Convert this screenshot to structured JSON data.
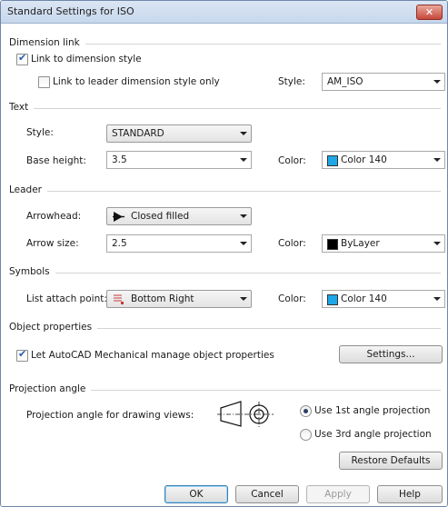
{
  "window": {
    "title": "Standard Settings for ISO",
    "close_glyph": "✕"
  },
  "dimension_link": {
    "heading": "Dimension link",
    "link_dim_style": {
      "label": "Link to dimension style",
      "checked": true
    },
    "link_leader_only": {
      "label": "Link to leader dimension style only",
      "checked": false
    },
    "style_label": "Style:",
    "style_value": "AM_ISO"
  },
  "text": {
    "heading": "Text",
    "style_label": "Style:",
    "style_value": "STANDARD",
    "base_height_label": "Base height:",
    "base_height_value": "3.5",
    "color_label": "Color:",
    "color_value": "Color 140",
    "color_swatch": "#1ea7e8"
  },
  "leader": {
    "heading": "Leader",
    "arrowhead_label": "Arrowhead:",
    "arrowhead_value": "Closed filled",
    "arrowhead_icon": "closed-filled-arrow-icon",
    "arrow_size_label": "Arrow size:",
    "arrow_size_value": "2.5",
    "color_label": "Color:",
    "color_value": "ByLayer",
    "color_swatch": "#000000"
  },
  "symbols": {
    "heading": "Symbols",
    "attach_label": "List attach point:",
    "attach_value": "Bottom Right",
    "attach_icon": "attach-point-icon",
    "color_label": "Color:",
    "color_value": "Color 140",
    "color_swatch": "#1ea7e8"
  },
  "object_properties": {
    "heading": "Object properties",
    "manage": {
      "label": "Let AutoCAD Mechanical manage object properties",
      "checked": true
    },
    "settings_button": "Settings..."
  },
  "projection": {
    "heading": "Projection angle",
    "label": "Projection angle for drawing views:",
    "symbol_icon": "first-angle-projection-icon",
    "option_1st": {
      "label": "Use 1st angle projection",
      "selected": true
    },
    "option_3rd": {
      "label": "Use 3rd angle projection",
      "selected": false
    },
    "restore_button": "Restore Defaults"
  },
  "footer": {
    "ok": "OK",
    "cancel": "Cancel",
    "apply": "Apply",
    "help": "Help",
    "apply_enabled": false
  }
}
